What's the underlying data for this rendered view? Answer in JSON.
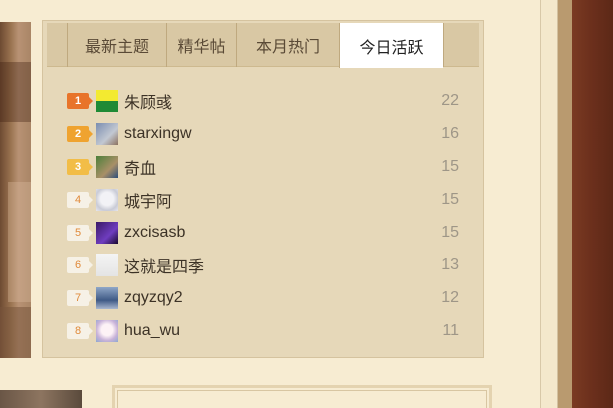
{
  "tabs": [
    {
      "label": "最新主题",
      "active": false
    },
    {
      "label": "精华帖",
      "active": false
    },
    {
      "label": "本月热门",
      "active": false
    },
    {
      "label": "今日活跃",
      "active": true
    }
  ],
  "ranking": [
    {
      "rank": "1",
      "name": "朱顾彧",
      "count": "22"
    },
    {
      "rank": "2",
      "name": "starxingw",
      "count": "16"
    },
    {
      "rank": "3",
      "name": "奇血",
      "count": "15"
    },
    {
      "rank": "4",
      "name": "城宇阿",
      "count": "15"
    },
    {
      "rank": "5",
      "name": "zxcisasb",
      "count": "15"
    },
    {
      "rank": "6",
      "name": "这就是四季",
      "count": "13"
    },
    {
      "rank": "7",
      "name": "zqyzqy2",
      "count": "12"
    },
    {
      "rank": "8",
      "name": "hua_wu",
      "count": "11"
    }
  ],
  "colors": {
    "panel_bg": "#e6d8b9",
    "active_tab_bg": "#ffffff",
    "rank1": "#e8742a",
    "rank2": "#efa330",
    "rank3": "#f2bd47"
  }
}
